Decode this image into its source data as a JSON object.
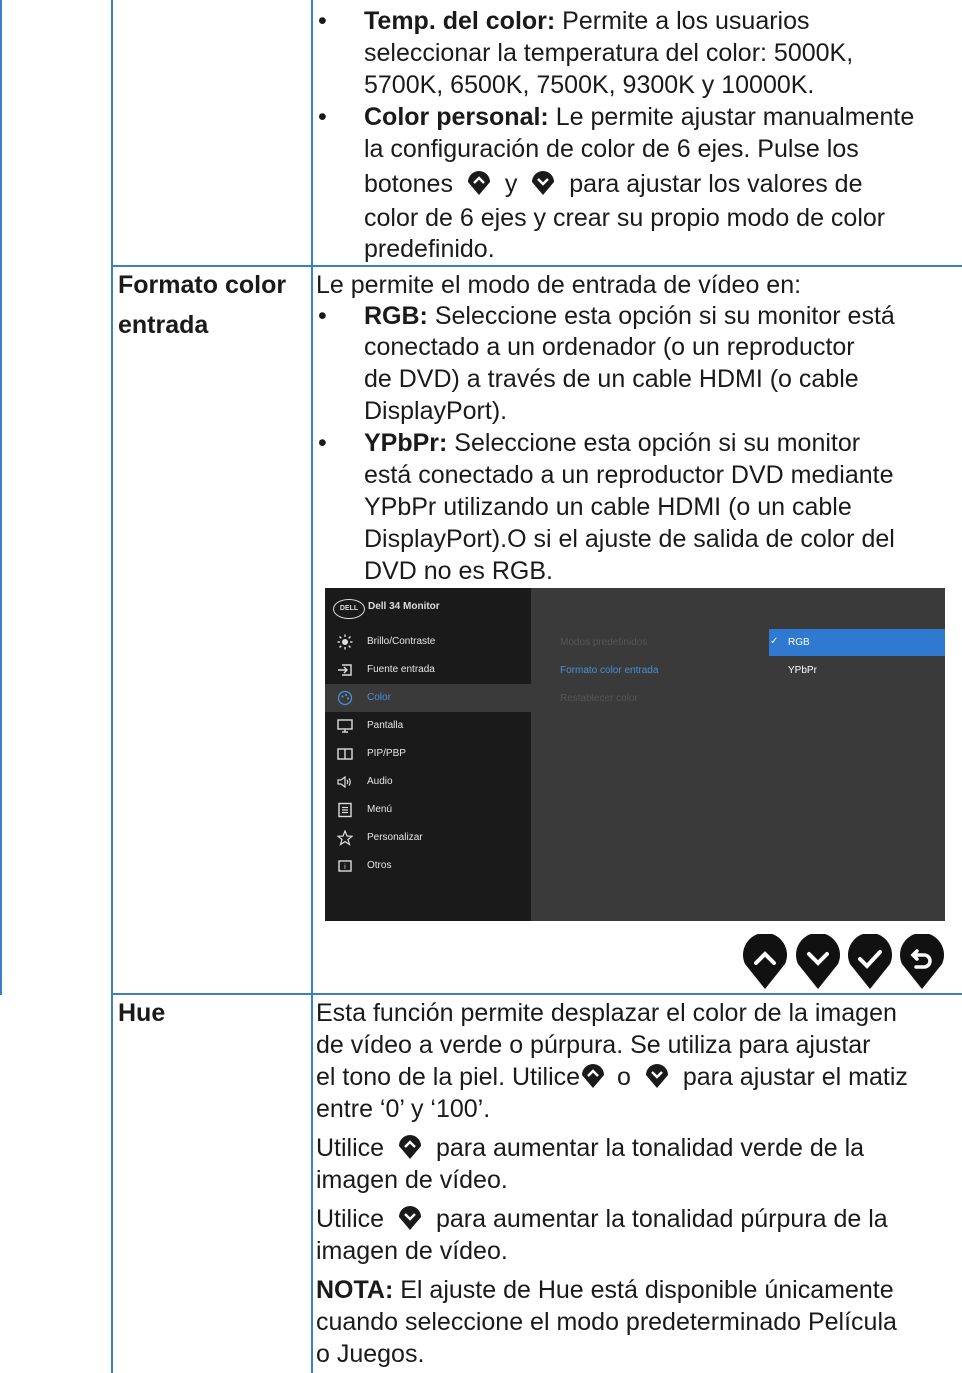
{
  "section_temp": {
    "label": "Temp. del color:",
    "line1": " Permite a los usuarios",
    "line2": "seleccionar la temperatura del color: 5000K,",
    "line3": "5700K, 6500K, 7500K, 9300K y 10000K."
  },
  "section_custom": {
    "label": "Color personal:",
    "line1": " Le permite ajustar manualmente",
    "line2": "la configuración de color de 6 ejes. Pulse los",
    "line3a": "botones",
    "line3b": "y",
    "line3c": "para ajustar los valores de",
    "line4": "color de 6 ejes y crear su propio modo de color",
    "line5": "predefinido."
  },
  "row_input_format": {
    "label_line1": "Formato color",
    "label_line2": "entrada",
    "intro": "Le permite el modo de entrada de vídeo en:",
    "rgb_label": "RGB:",
    "rgb_line1": " Seleccione esta opción si su monitor está",
    "rgb_line2": "conectado a un ordenador (o un reproductor",
    "rgb_line3": "de DVD) a través de un cable HDMI (o cable",
    "rgb_line4": "DisplayPort).",
    "ypbpr_label": "YPbPr:",
    "ypbpr_line1": " Seleccione esta opción si su monitor",
    "ypbpr_line2": "está conectado a un reproductor DVD mediante",
    "ypbpr_line3": "YPbPr utilizando un cable HDMI (o un cable",
    "ypbpr_line4": "DisplayPort).O si el ajuste de salida de color del",
    "ypbpr_line5": "DVD no es RGB."
  },
  "osd": {
    "logo": "DELL",
    "model": "Dell  34 Monitor",
    "menu": [
      {
        "label": "Brillo/Contraste",
        "icon": "brightness-icon"
      },
      {
        "label": "Fuente entrada",
        "icon": "input-source-icon"
      },
      {
        "label": "Color",
        "icon": "color-palette-icon"
      },
      {
        "label": "Pantalla",
        "icon": "display-icon"
      },
      {
        "label": "PIP/PBP",
        "icon": "pip-pbp-icon"
      },
      {
        "label": "Audio",
        "icon": "audio-icon"
      },
      {
        "label": "Menú",
        "icon": "menu-icon"
      },
      {
        "label": "Personalizar",
        "icon": "star-icon"
      },
      {
        "label": "Otros",
        "icon": "others-icon"
      }
    ],
    "selected_menu": "Color",
    "submenu": [
      "Modos predefinidos",
      "Formato color entrada",
      "Restablecer color"
    ],
    "options": [
      "RGB",
      "YPbPr"
    ],
    "selected_option": "RGB",
    "check": "✓",
    "accent": "#2f7ad0"
  },
  "nav_buttons": [
    "up-icon",
    "down-icon",
    "check-icon",
    "back-icon"
  ],
  "row_hue": {
    "label": "Hue",
    "p1_line1": "Esta función permite desplazar el color de la imagen",
    "p1_line2": "de vídeo a verde o púrpura. Se utiliza para ajustar",
    "p1_line3a": "el tono de la piel. Utilice",
    "p1_line3b": "o",
    "p1_line3c": "para ajustar el matiz",
    "p1_line4": "entre ‘0’ y ‘100’.",
    "p2_line1a": "Utilice",
    "p2_line1b": "para aumentar la tonalidad verde de la",
    "p2_line2": "imagen de vídeo.",
    "p3_line1a": "Utilice",
    "p3_line1b": "para aumentar la tonalidad púrpura de la",
    "p3_line2": "imagen de vídeo.",
    "note_label": "NOTA:",
    "note_line1": " El ajuste de Hue está disponible únicamente",
    "note_line2": "cuando seleccione el modo predeterminado Película",
    "note_line3": "o Juegos."
  },
  "bullet": "•",
  "border_color": "#3b7fc4"
}
